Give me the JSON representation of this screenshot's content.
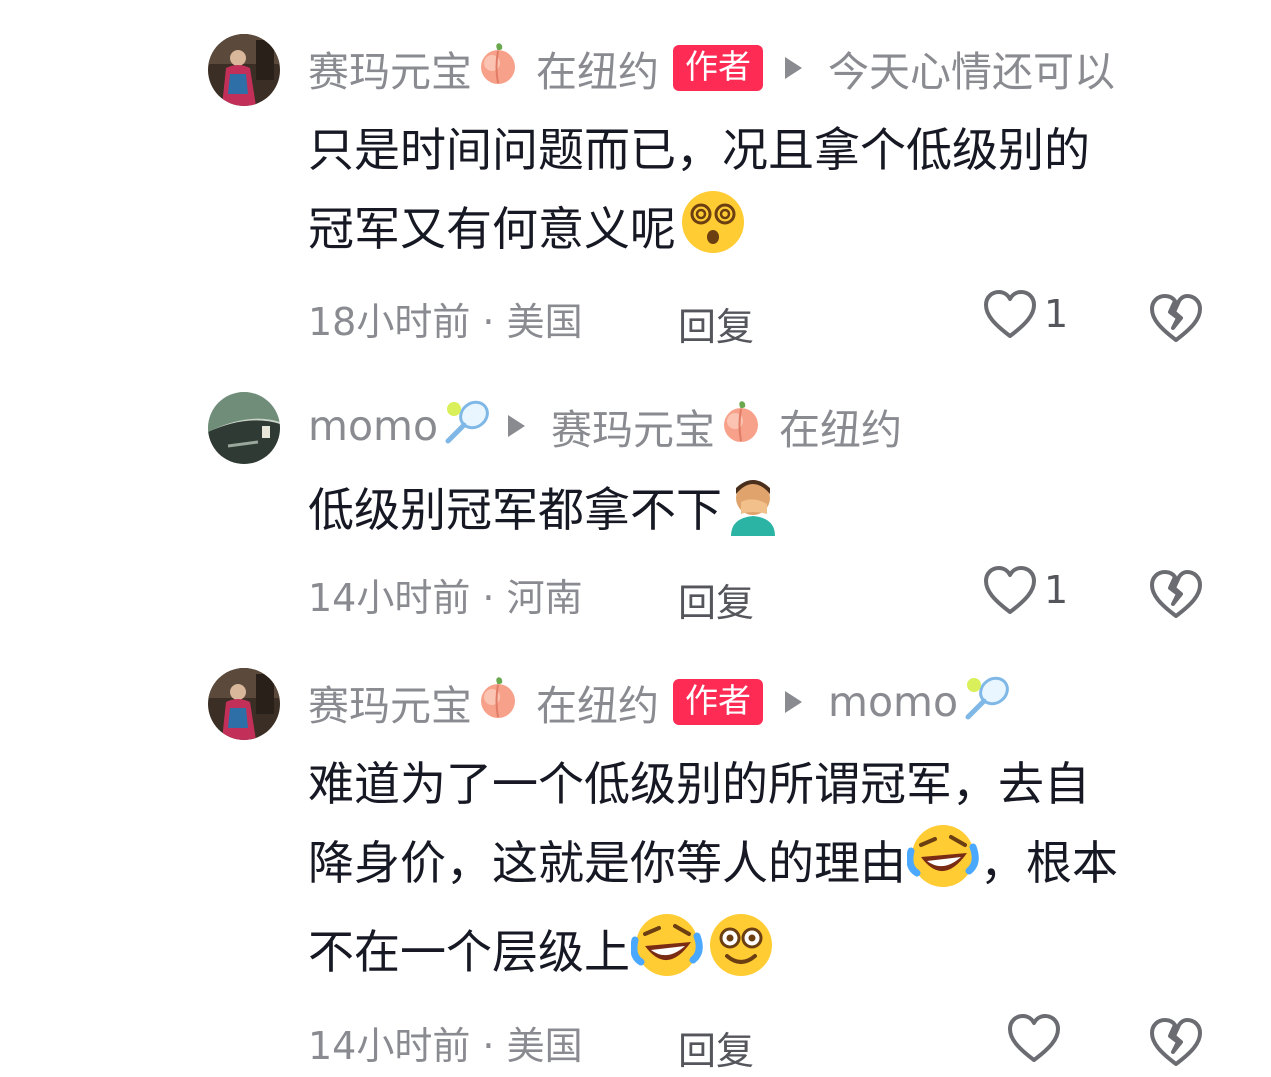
{
  "comments": [
    {
      "username": "赛玛元宝",
      "username_emoji": "peach",
      "location_tag": "在纽约",
      "author_badge": "作者",
      "reply_to": "今天心情还可以",
      "text_line1": "只是时间问题而已，况且拿个低级别的",
      "text_line2": "冠军又有何意义呢",
      "text_emoji": "dizzy-face",
      "meta": "18小时前 · 美国",
      "reply_label": "回复",
      "likes": "1"
    },
    {
      "username": "momo",
      "username_emoji": "tennis-racket",
      "reply_to": "赛玛元宝",
      "reply_to_emoji": "peach",
      "reply_to_location": "在纽约",
      "text_line1": "低级别冠军都拿不下",
      "text_emoji": "facepalm",
      "meta": "14小时前 · 河南",
      "reply_label": "回复",
      "likes": "1"
    },
    {
      "username": "赛玛元宝",
      "username_emoji": "peach",
      "location_tag": "在纽约",
      "author_badge": "作者",
      "reply_to": "momo",
      "reply_to_emoji": "tennis-racket",
      "text_line1": "难道为了一个低级别的所谓冠军，去自",
      "text_line2a": "降身价，这就是你等人的理由",
      "text_line2b": "，根本",
      "text_line3": "不在一个层级上",
      "text_emoji_a": "rolling-laughing",
      "text_emoji_b": "grinning-eyes",
      "meta": "14小时前 · 美国",
      "reply_label": "回复"
    }
  ],
  "colors": {
    "author_badge_bg": "#fe2c55",
    "meta_text": "#8a8b91",
    "body_text": "#161823"
  }
}
